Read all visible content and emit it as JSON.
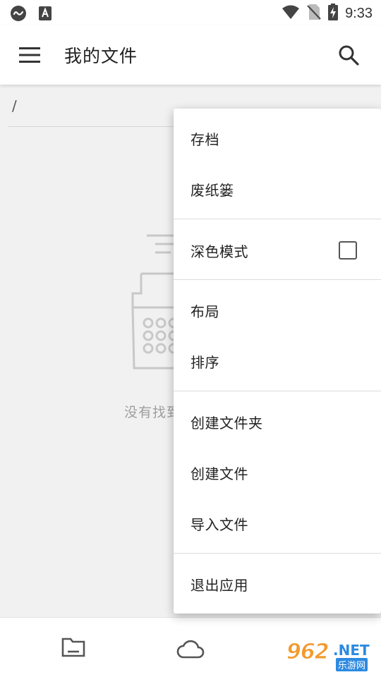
{
  "status_bar": {
    "time": "9:33",
    "icons": [
      "app-notification-icon",
      "a-notification-icon",
      "wifi-icon",
      "no-sim-icon",
      "battery-charging-icon"
    ]
  },
  "app_bar": {
    "title": "我的文件",
    "menu_icon": "hamburger-menu-icon",
    "search_icon": "search-icon"
  },
  "content": {
    "path": "/",
    "empty_text": "没有找到",
    "illustration": "typewriter-icon"
  },
  "overflow_menu": {
    "items": [
      {
        "label": "存档"
      },
      {
        "label": "废纸篓"
      },
      {
        "label": "深色模式",
        "checkbox": false
      },
      {
        "label": "布局"
      },
      {
        "label": "排序"
      },
      {
        "label": "创建文件夹"
      },
      {
        "label": "创建文件"
      },
      {
        "label": "导入文件"
      },
      {
        "label": "退出应用"
      }
    ]
  },
  "bottom_nav": {
    "items": [
      {
        "icon": "folder-icon"
      },
      {
        "icon": "cloud-icon"
      }
    ]
  },
  "watermark": {
    "number": "962",
    "domain": ".NET",
    "subtitle": "乐游网"
  },
  "colors": {
    "background": "#f1f1f1",
    "surface": "#ffffff",
    "text": "#222222",
    "muted_text": "#9e9e9e",
    "watermark_orange": "#f29a2e",
    "watermark_blue": "#2d8ae0"
  }
}
